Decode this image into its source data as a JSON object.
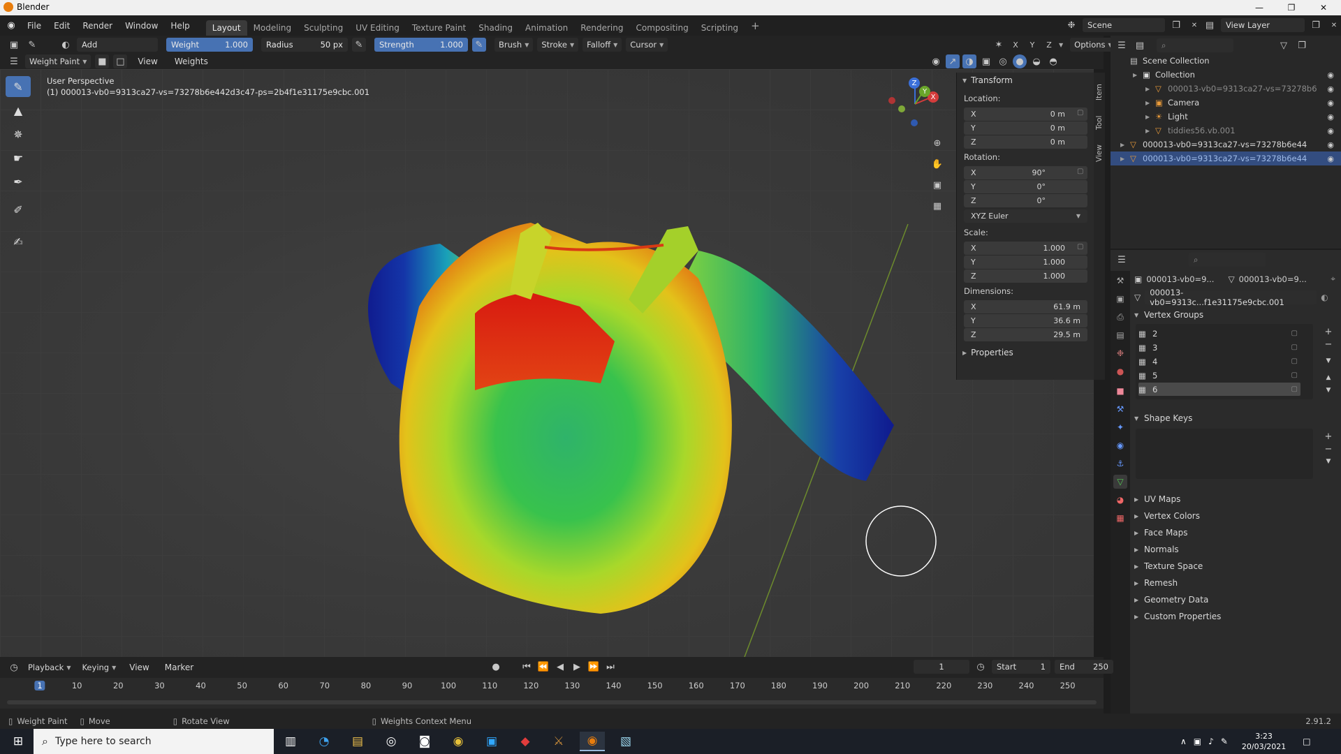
{
  "window": {
    "title": "Blender"
  },
  "menu": [
    "File",
    "Edit",
    "Render",
    "Window",
    "Help"
  ],
  "workspaces": [
    {
      "label": "Layout",
      "active": true
    },
    {
      "label": "Modeling"
    },
    {
      "label": "Sculpting"
    },
    {
      "label": "UV Editing"
    },
    {
      "label": "Texture Paint"
    },
    {
      "label": "Shading"
    },
    {
      "label": "Animation"
    },
    {
      "label": "Rendering"
    },
    {
      "label": "Compositing"
    },
    {
      "label": "Scripting"
    }
  ],
  "workspace_add": "+",
  "scene": {
    "name": "Scene",
    "view_layer": "View Layer"
  },
  "toolbar": {
    "blend_mode": "Add",
    "weight": {
      "label": "Weight",
      "value": "1.000"
    },
    "radius": {
      "label": "Radius",
      "value": "50 px"
    },
    "strength": {
      "label": "Strength",
      "value": "1.000"
    },
    "brush": "Brush",
    "stroke": "Stroke",
    "falloff": "Falloff",
    "cursor": "Cursor",
    "options": "Options",
    "axis": [
      "X",
      "Y",
      "Z"
    ]
  },
  "header": {
    "mode": "Weight Paint",
    "view": "View",
    "weights": "Weights"
  },
  "viewport": {
    "perspective": "User Perspective",
    "object_label": "(1) 000013-vb0=9313ca27-vs=73278b6e442d3c47-ps=2b4f1e31175e9cbc.001",
    "gizmo": {
      "x": "X",
      "y": "Y",
      "z": "Z"
    }
  },
  "npanel": {
    "transform": "Transform",
    "location": {
      "label": "Location:",
      "x": "0 m",
      "y": "0 m",
      "z": "0 m"
    },
    "rotation": {
      "label": "Rotation:",
      "x": "90°",
      "y": "0°",
      "z": "0°"
    },
    "rotation_mode": "XYZ Euler",
    "scale": {
      "label": "Scale:",
      "x": "1.000",
      "y": "1.000",
      "z": "1.000"
    },
    "dimensions": {
      "label": "Dimensions:",
      "x": "61.9 m",
      "y": "36.6 m",
      "z": "29.5 m"
    },
    "properties": "Properties",
    "axis": [
      "X",
      "Y",
      "Z"
    ],
    "tabs": [
      "Item",
      "Tool",
      "View"
    ]
  },
  "outliner": {
    "rows": [
      {
        "label": "Scene Collection",
        "indent": 0
      },
      {
        "label": "Collection",
        "indent": 1
      },
      {
        "label": "000013-vb0=9313ca27-vs=73278b6",
        "indent": 2,
        "dim": true
      },
      {
        "label": "Camera",
        "indent": 2
      },
      {
        "label": "Light",
        "indent": 2
      },
      {
        "label": "tiddies56.vb.001",
        "indent": 2,
        "dim": true
      },
      {
        "label": "000013-vb0=9313ca27-vs=73278b6e44",
        "indent": 0
      },
      {
        "label": "000013-vb0=9313ca27-vs=73278b6e44",
        "indent": 0,
        "selected": true
      }
    ]
  },
  "properties": {
    "obj_name": "000013-vb0=9...",
    "mesh_name": "000013-vb0=9...",
    "datablock": "000013-vb0=9313c...f1e31175e9cbc.001",
    "vertex_groups_title": "Vertex Groups",
    "vertex_groups": [
      "2",
      "3",
      "4",
      "5",
      "6"
    ],
    "shape_keys_title": "Shape Keys",
    "sections": [
      "UV Maps",
      "Vertex Colors",
      "Face Maps",
      "Normals",
      "Texture Space",
      "Remesh",
      "Geometry Data",
      "Custom Properties"
    ]
  },
  "timeline": {
    "playback": "Playback",
    "keying": "Keying",
    "view": "View",
    "marker": "Marker",
    "current_frame": "1",
    "start_label": "Start",
    "start": "1",
    "end_label": "End",
    "end": "250",
    "ticks": [
      "1",
      "10",
      "20",
      "30",
      "40",
      "50",
      "60",
      "70",
      "80",
      "90",
      "100",
      "110",
      "120",
      "130",
      "140",
      "150",
      "160",
      "170",
      "180",
      "190",
      "200",
      "210",
      "220",
      "230",
      "240",
      "250"
    ]
  },
  "status": {
    "mode": "Weight Paint",
    "move": "Move",
    "rotate": "Rotate View",
    "context": "Weights Context Menu",
    "version": "2.91.2"
  },
  "taskbar": {
    "search_placeholder": "Type here to search",
    "time": "3:23",
    "date": "20/03/2021"
  }
}
